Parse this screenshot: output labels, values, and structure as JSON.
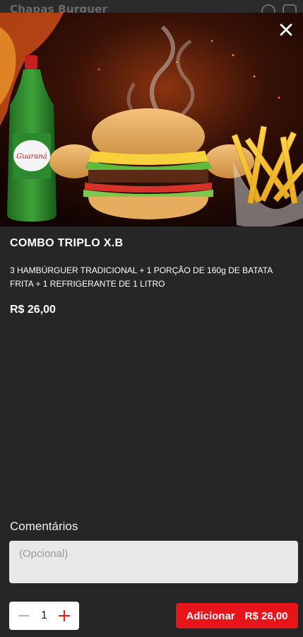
{
  "background_page": {
    "title": "Chapas Burguer",
    "icons": [
      "whatsapp-icon",
      "instagram-icon"
    ]
  },
  "product": {
    "image_alt": "Combo triplo X.B com refrigerante Guaraná e batata frita",
    "name": "COMBO TRIPLO X.B",
    "description": "3 HAMBÚRGUER TRADICIONAL + 1 PORÇÃO DE 160g DE BATATA FRITA + 1 REFRIGERANTE DE 1 LITRO",
    "price": "R$ 26,00"
  },
  "comments": {
    "label": "Comentários",
    "placeholder": "(Opcional)",
    "value": ""
  },
  "quantity": {
    "value": "1"
  },
  "add_button": {
    "label": "Adicionar",
    "price": "R$ 26,00"
  },
  "colors": {
    "background": "#262626",
    "accent": "#e8141b",
    "text": "#ffffff",
    "input_bg": "#e8e8e8"
  }
}
